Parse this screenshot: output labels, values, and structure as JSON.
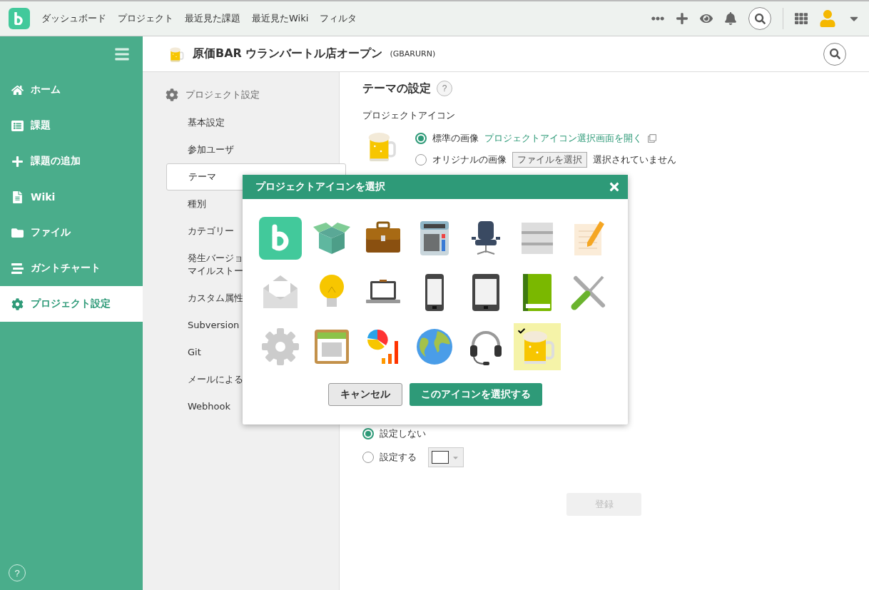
{
  "topbar": {
    "nav": [
      "ダッシュボード",
      "プロジェクト",
      "最近見た課題",
      "最近見たWiki",
      "フィルタ"
    ]
  },
  "sidebar": {
    "items": [
      {
        "label": "ホーム",
        "kind": "home",
        "selected": false
      },
      {
        "label": "課題",
        "kind": "list",
        "selected": false
      },
      {
        "label": "課題の追加",
        "kind": "plus",
        "selected": false
      },
      {
        "label": "Wiki",
        "kind": "doc",
        "selected": false
      },
      {
        "label": "ファイル",
        "kind": "folder",
        "selected": false
      },
      {
        "label": "ガントチャート",
        "kind": "gantt",
        "selected": false
      },
      {
        "label": "プロジェクト設定",
        "kind": "gear",
        "selected": true
      }
    ],
    "help": "?"
  },
  "project": {
    "name": "原価BAR ウランバートル店オープン",
    "key": "(GBARURN)"
  },
  "settings_nav": {
    "title": "プロジェクト設定",
    "items": [
      {
        "label": "基本設定",
        "selected": false
      },
      {
        "label": "参加ユーザ",
        "selected": false
      },
      {
        "label": "テーマ",
        "selected": true
      },
      {
        "label": "種別",
        "selected": false
      },
      {
        "label": "カテゴリー",
        "selected": false
      },
      {
        "label": "発生バージョマイルストー",
        "selected": false
      },
      {
        "label": "カスタム属性",
        "selected": false
      },
      {
        "label": "Subversion",
        "selected": false
      },
      {
        "label": "Git",
        "selected": false
      },
      {
        "label": "メールによる",
        "selected": false
      },
      {
        "label": "Webhook",
        "selected": false
      }
    ]
  },
  "content": {
    "title": "テーマの設定",
    "help": "?",
    "icon_label": "プロジェクトアイコン",
    "icon_options": [
      {
        "label": "標準の画像",
        "selected": true,
        "link": "プロジェクトアイコン選択画面を開く"
      },
      {
        "label": "オリジナルの画像",
        "selected": false,
        "file_button": "ファイルを選択",
        "file_status": "選択されていません"
      }
    ],
    "color_options": [
      {
        "label": "設定しない",
        "selected": true
      },
      {
        "label": "設定する",
        "selected": false
      }
    ],
    "submit": {
      "label": "登録",
      "disabled": true
    }
  },
  "dialog": {
    "title": "プロジェクトアイコンを選択",
    "icons": [
      {
        "kind": "logo",
        "selected": false
      },
      {
        "kind": "box",
        "selected": false
      },
      {
        "kind": "briefcase",
        "selected": false
      },
      {
        "kind": "calculator",
        "selected": false
      },
      {
        "kind": "chair",
        "selected": false
      },
      {
        "kind": "server",
        "selected": false
      },
      {
        "kind": "notepad",
        "selected": false
      },
      {
        "kind": "envelope",
        "selected": false
      },
      {
        "kind": "bulb",
        "selected": false
      },
      {
        "kind": "laptop",
        "selected": false
      },
      {
        "kind": "phone",
        "selected": false
      },
      {
        "kind": "tablet",
        "selected": false
      },
      {
        "kind": "book",
        "selected": false
      },
      {
        "kind": "tools",
        "selected": false
      },
      {
        "kind": "gear",
        "selected": false
      },
      {
        "kind": "calendar",
        "selected": false
      },
      {
        "kind": "chart",
        "selected": false
      },
      {
        "kind": "globe",
        "selected": false
      },
      {
        "kind": "headset",
        "selected": false
      },
      {
        "kind": "beer",
        "selected": true
      }
    ],
    "cancel": "キャンセル",
    "confirm": "このアイコンを選択する"
  }
}
